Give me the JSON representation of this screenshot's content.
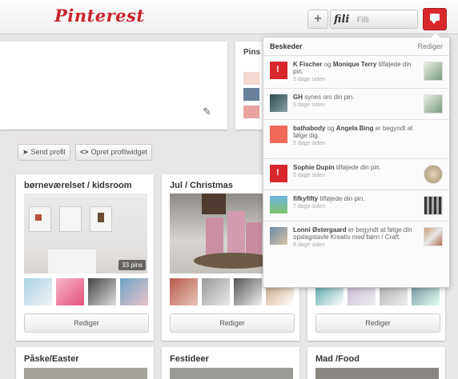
{
  "header": {
    "logo": "Pinterest",
    "plus_label": "+",
    "user_logo": "fili",
    "user_name": "Filli"
  },
  "profile": {
    "pins_title": "Pins f"
  },
  "actions": {
    "send_profile": "Send profil",
    "create_widget": "Opret profilwidget"
  },
  "boards": [
    {
      "title": "børneværelset / kidsroom",
      "pin_count": "33 pins",
      "edit": "Rediger"
    },
    {
      "title": "Jul / Christmas",
      "edit": "Rediger"
    },
    {
      "title": "",
      "edit": "Rediger"
    }
  ],
  "bottom_boards": [
    {
      "title": "Påske/Easter"
    },
    {
      "title": "Festideer"
    },
    {
      "title": "Mad /Food"
    }
  ],
  "messages_panel": {
    "title": "Beskeder",
    "edit": "Rediger",
    "items": [
      {
        "user1": "K Fischer",
        "mid": " og ",
        "user2": "Monique Terry",
        "action": " tilføjede din pin.",
        "time": "5 dage siden"
      },
      {
        "user1": "GH",
        "mid": "",
        "user2": "",
        "action": " synes om din pin.",
        "time": "5 dage siden"
      },
      {
        "user1": "bathabody",
        "mid": " og ",
        "user2": "Angela Bing",
        "action": " er begyndt at følge dig.",
        "time": "5 dage siden"
      },
      {
        "user1": "Sophie Dupin",
        "mid": "",
        "user2": "",
        "action": " tilføjede din pin.",
        "time": "6 dage siden"
      },
      {
        "user1": "fifkyfifty",
        "mid": "",
        "user2": "",
        "action": " tilføjede din pin.",
        "time": "7 dage siden"
      },
      {
        "user1": "Lonni Østergaard",
        "mid": "",
        "user2": "",
        "action": " er begyndt at følge din opslagstavle Kreativ med børn / Craft.",
        "time": "8 dage siden"
      }
    ]
  },
  "colors": {
    "brand_red": "#c8232c",
    "message_button": "#d9272e"
  }
}
